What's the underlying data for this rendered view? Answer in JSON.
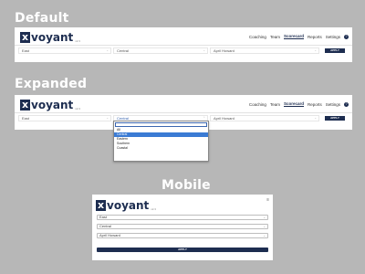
{
  "sections": {
    "default": "Default",
    "expanded": "Expanded",
    "mobile": "Mobile"
  },
  "app": {
    "logo_x": "x",
    "logo_word": "voyant",
    "version": "v2.3"
  },
  "nav": [
    "Coaching",
    "Team",
    "Scorecard",
    "Reports",
    "Settings"
  ],
  "help_icon": "?",
  "filters": {
    "region": "East",
    "area": "Central",
    "person": "April Howard",
    "apply": "APPLY"
  },
  "dropdown": {
    "options": [
      "All",
      "Central",
      "Eastern",
      "Southern",
      "Coastal"
    ],
    "selected": "Central"
  },
  "mobile_menu_icon": "≡"
}
